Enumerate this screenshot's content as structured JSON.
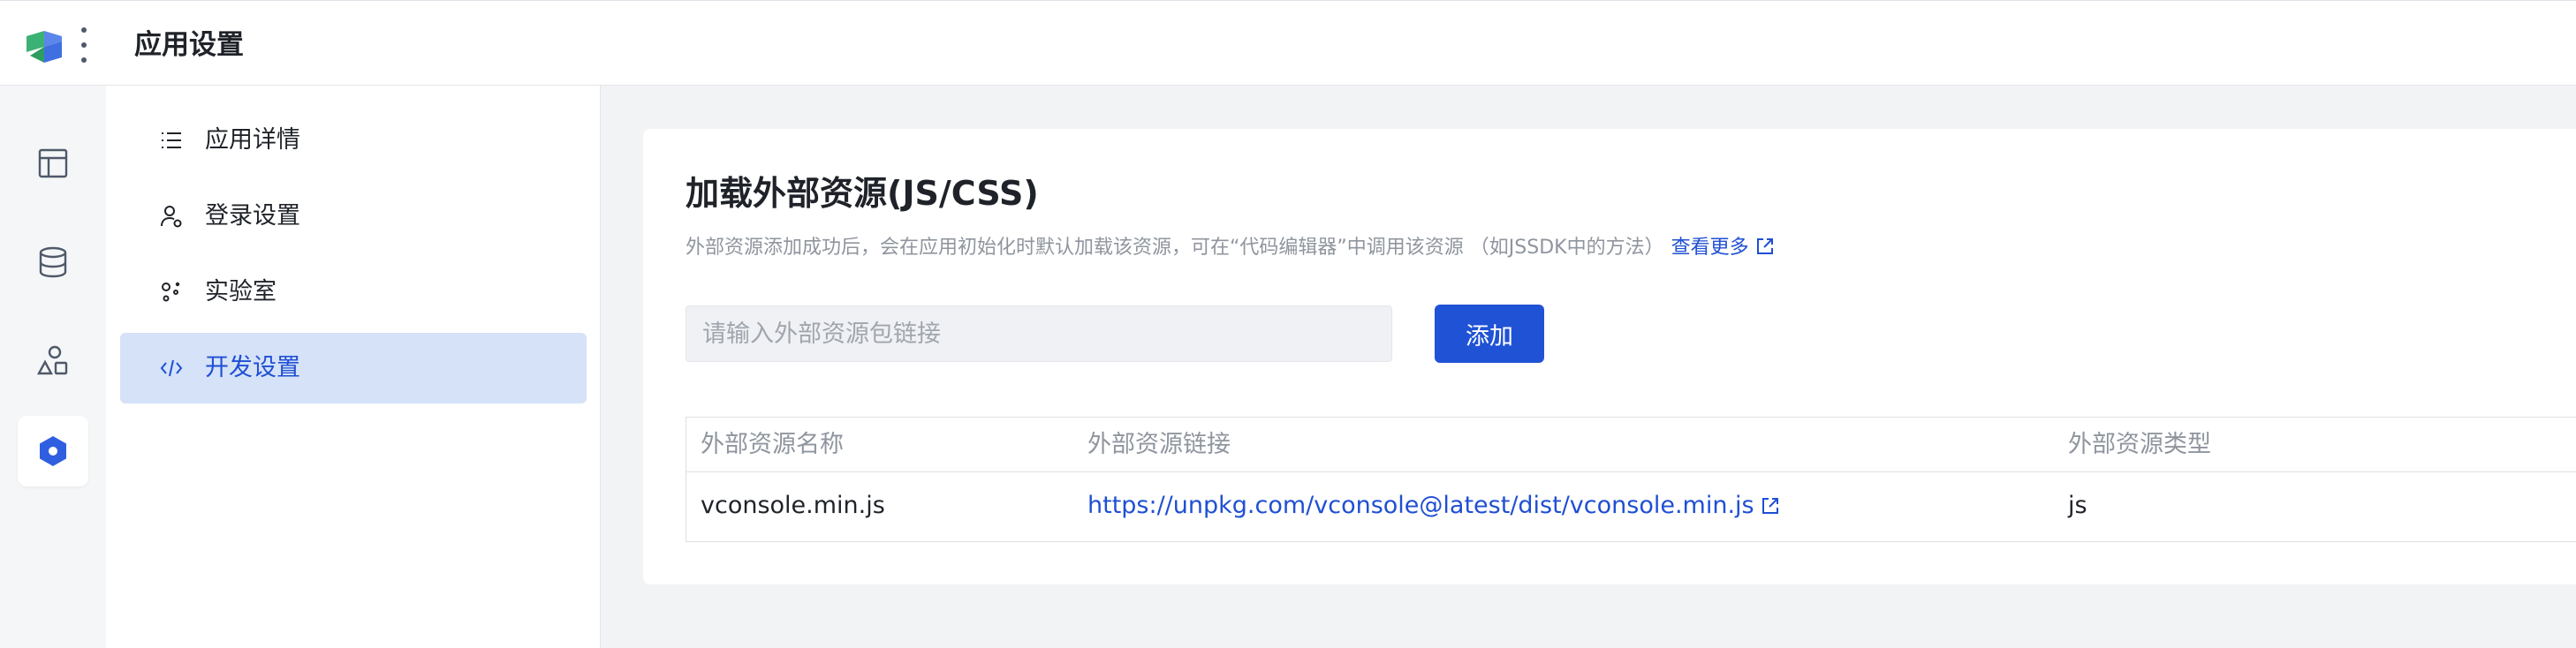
{
  "header": {
    "title": "应用设置"
  },
  "rail": {
    "items": [
      {
        "icon": "layout-icon",
        "active": false
      },
      {
        "icon": "database-icon",
        "active": false
      },
      {
        "icon": "components-icon",
        "active": false
      },
      {
        "icon": "settings-hex-icon",
        "active": true
      }
    ]
  },
  "nav": {
    "items": [
      {
        "label": "应用详情",
        "icon": "list-icon",
        "active": false
      },
      {
        "label": "登录设置",
        "icon": "user-settings-icon",
        "active": false
      },
      {
        "label": "实验室",
        "icon": "lab-icon",
        "active": false
      },
      {
        "label": "开发设置",
        "icon": "code-icon",
        "active": true
      }
    ]
  },
  "main": {
    "title": "加载外部资源(JS/CSS)",
    "description": "外部资源添加成功后，会在应用初始化时默认加载该资源，可在“代码编辑器”中调用该资源 （如JSSDK中的方法）",
    "more_link": "查看更多",
    "input_placeholder": "请输入外部资源包链接",
    "add_button": "添加",
    "table": {
      "columns": [
        "外部资源名称",
        "外部资源链接",
        "外部资源类型"
      ],
      "rows": [
        {
          "name": "vconsole.min.js",
          "url": "https://unpkg.com/vconsole@latest/dist/vconsole.min.js",
          "type": "js"
        }
      ]
    }
  },
  "colors": {
    "accent": "#2052d6",
    "link": "#1f4fd3",
    "active_bg": "#d5e2f8"
  }
}
